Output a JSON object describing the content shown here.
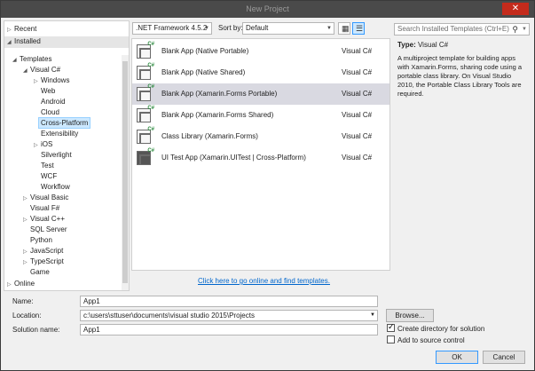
{
  "window": {
    "title": "New Project",
    "close_glyph": "✕"
  },
  "tree": {
    "recent": "Recent",
    "installed": "Installed",
    "templates": "Templates",
    "visual_csharp": "Visual C#",
    "csharp_children": [
      "Windows",
      "Web",
      "Android",
      "Cloud",
      "Cross-Platform",
      "Extensibility",
      "iOS",
      "Silverlight",
      "Test",
      "WCF",
      "Workflow"
    ],
    "others": [
      "Visual Basic",
      "Visual F#",
      "Visual C++",
      "SQL Server",
      "Python",
      "JavaScript",
      "TypeScript",
      "Game"
    ],
    "online": "Online"
  },
  "toolbar": {
    "framework": ".NET Framework 4.5.2",
    "sort_label": "Sort by:",
    "sort_value": "Default"
  },
  "templates": [
    {
      "name": "Blank App (Native Portable)",
      "lang": "Visual C#",
      "icon": "blank-app-icon"
    },
    {
      "name": "Blank App (Native Shared)",
      "lang": "Visual C#",
      "icon": "blank-app-icon"
    },
    {
      "name": "Blank App (Xamarin.Forms Portable)",
      "lang": "Visual C#",
      "icon": "blank-app-icon"
    },
    {
      "name": "Blank App (Xamarin.Forms Shared)",
      "lang": "Visual C#",
      "icon": "blank-app-icon"
    },
    {
      "name": "Class Library (Xamarin.Forms)",
      "lang": "Visual C#",
      "icon": "class-library-icon"
    },
    {
      "name": "UI Test App (Xamarin.UITest | Cross-Platform)",
      "lang": "Visual C#",
      "icon": "ui-test-icon"
    }
  ],
  "online_link": "Click here to go online and find templates.",
  "search": {
    "placeholder": "Search Installed Templates (Ctrl+E)"
  },
  "details": {
    "type_label": "Type:",
    "type_value": "Visual C#",
    "description": "A multiproject template for building apps with Xamarin.Forms, sharing code using a portable class library. On Visual Studio 2010, the Portable Class Library Tools are required."
  },
  "form": {
    "name_label": "Name:",
    "name_value": "App1",
    "location_label": "Location:",
    "location_value": "c:\\users\\sttuser\\documents\\visual studio 2015\\Projects",
    "solution_label": "Solution name:",
    "solution_value": "App1",
    "browse_label": "Browse...",
    "create_dir_label": "Create directory for solution",
    "source_control_label": "Add to source control",
    "ok_label": "OK",
    "cancel_label": "Cancel"
  }
}
